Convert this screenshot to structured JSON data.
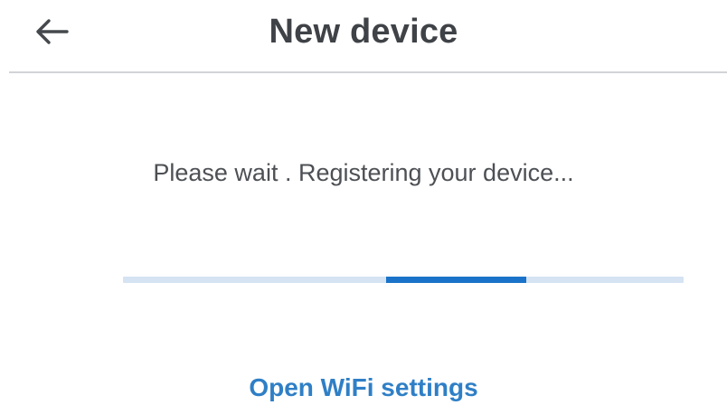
{
  "header": {
    "back_icon": "arrow-left-icon",
    "title": "New device"
  },
  "main": {
    "status_text": "Please wait . Registering your device...",
    "progress": {
      "type": "indeterminate",
      "segment_start": 0.47,
      "segment_end": 0.72
    },
    "wifi_link_label": "Open WiFi settings"
  },
  "colors": {
    "title": "#3f4246",
    "body_text": "#4d5054",
    "divider": "#d2d4d6",
    "progress_track": "#d5e3f3",
    "progress_fill": "#1a73c9",
    "link": "#2f7fc6"
  }
}
